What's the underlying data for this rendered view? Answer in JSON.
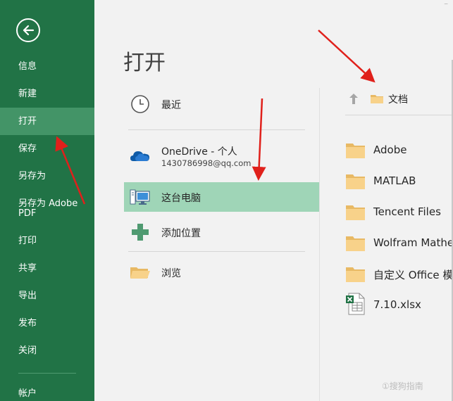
{
  "sidebar": {
    "items": [
      {
        "label": "信息"
      },
      {
        "label": "新建"
      },
      {
        "label": "打开"
      },
      {
        "label": "保存"
      },
      {
        "label": "另存为"
      },
      {
        "label_line1": "另存为 Adobe",
        "label_line2": "PDF"
      },
      {
        "label": "打印"
      },
      {
        "label": "共享"
      },
      {
        "label": "导出"
      },
      {
        "label": "发布"
      },
      {
        "label": "关闭"
      },
      {
        "label": "帐户"
      }
    ]
  },
  "main": {
    "title": "打开",
    "locations": [
      {
        "label": "最近",
        "icon": "clock-icon"
      },
      {
        "label": "OneDrive - 个人",
        "sublabel": "1430786998@qq.com",
        "icon": "onedrive-cloud-icon"
      },
      {
        "label": "这台电脑",
        "icon": "computer-icon"
      },
      {
        "label": "添加位置",
        "icon": "plus-icon"
      },
      {
        "label": "浏览",
        "icon": "folder-open-icon"
      }
    ]
  },
  "browser": {
    "breadcrumb": "文档",
    "files": [
      {
        "name": "Adobe",
        "icon": "folder-icon"
      },
      {
        "name": "MATLAB",
        "icon": "folder-icon"
      },
      {
        "name": "Tencent Files",
        "icon": "folder-icon"
      },
      {
        "name": "Wolfram Mathe",
        "icon": "folder-icon"
      },
      {
        "name": "自定义 Office 模",
        "icon": "folder-icon"
      },
      {
        "name": "7.10.xlsx",
        "icon": "excel-file-icon"
      }
    ]
  },
  "watermark": "①搜狗指南",
  "colors": {
    "sidebar": "#217346",
    "sidebar_selected": "#439467",
    "location_selected": "#9fd5b7",
    "arrow": "#e0201b",
    "folder": "#f8d28a"
  }
}
